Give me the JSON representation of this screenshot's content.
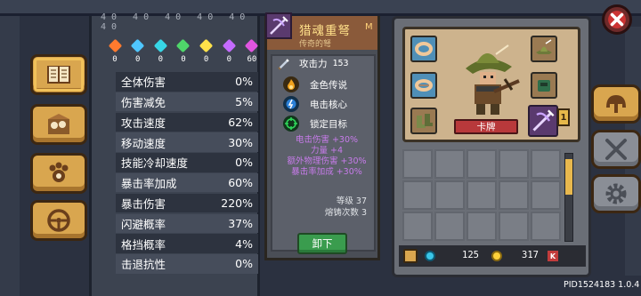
{
  "stats_header_numbers": "40 40 40 40 40 40",
  "gems": [
    {
      "icon": "fire-gem-icon",
      "color": "#ff7a2e",
      "value": "0"
    },
    {
      "icon": "ice-gem-icon",
      "color": "#4fc6ff",
      "value": "0"
    },
    {
      "icon": "water-gem-icon",
      "color": "#37d6e6",
      "value": "0"
    },
    {
      "icon": "poison-gem-icon",
      "color": "#4fd66a",
      "value": "0"
    },
    {
      "icon": "lightning-gem-icon",
      "color": "#ffe24a",
      "value": "0"
    },
    {
      "icon": "shadow-gem-icon",
      "color": "#c46bff",
      "value": "0"
    },
    {
      "icon": "gold-gem-icon",
      "color": "#e055e0",
      "value": "60"
    }
  ],
  "stats": [
    {
      "label": "全体伤害",
      "value": "0%"
    },
    {
      "label": "伤害减免",
      "value": "5%"
    },
    {
      "label": "攻击速度",
      "value": "62%"
    },
    {
      "label": "移动速度",
      "value": "30%"
    },
    {
      "label": "技能冷却速度",
      "value": "0%"
    },
    {
      "label": "暴击率加成",
      "value": "60%"
    },
    {
      "label": "暴击伤害",
      "value": "220%"
    },
    {
      "label": "闪避概率",
      "value": "37%"
    },
    {
      "label": "格挡概率",
      "value": "4%"
    },
    {
      "label": "击退抗性",
      "value": "0%"
    }
  ],
  "weapon": {
    "name": "猎魂重弩",
    "tag": "M",
    "subtitle": "传奇的弩",
    "attack_label": "攻击力",
    "attack_value": "153",
    "properties": [
      {
        "label": "金色传说",
        "icon": "flame-orb-icon",
        "color": "#f0a21e"
      },
      {
        "label": "电击核心",
        "icon": "electric-orb-icon",
        "color": "#2a7fd6"
      },
      {
        "label": "锁定目标",
        "icon": "crosshair-icon",
        "color": "#2fa84a"
      }
    ],
    "bonuses": [
      "电击伤害 +30%",
      "力量 +4",
      "额外物理伤害 +30%",
      "暴击率加成 +30%"
    ],
    "level_line": "等级 37",
    "forge_line": "熔铸次数 3",
    "unequip_label": "卸下"
  },
  "character": {
    "name": "卡牌"
  },
  "equip_level": "1",
  "currency": {
    "gems": "125",
    "gold": "317"
  },
  "currency_suffix": "K",
  "build_id": "PID1524183 1.0.4",
  "colors": {
    "accent_gold": "#d9a64f",
    "epic_purple": "#c77bea",
    "danger_red": "#b8393b"
  }
}
